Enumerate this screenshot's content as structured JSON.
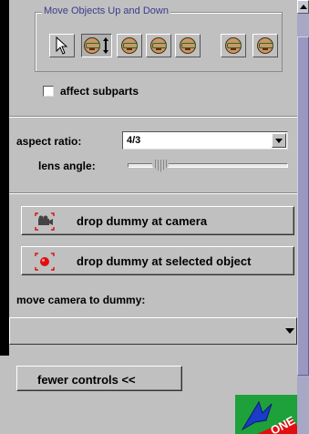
{
  "move_objects": {
    "group_title": "Move Objects Up and Down",
    "tools": [
      {
        "name": "pointer-tool",
        "selected": false
      },
      {
        "name": "up-down-tool",
        "selected": true
      },
      {
        "name": "face-tool-1",
        "selected": false
      },
      {
        "name": "face-tool-2",
        "selected": false
      },
      {
        "name": "face-tool-3",
        "selected": false
      },
      {
        "name": "face-tool-4",
        "selected": false
      },
      {
        "name": "face-tool-5",
        "selected": false
      }
    ],
    "affect_subparts": {
      "label": "affect subparts",
      "checked": false
    }
  },
  "camera": {
    "aspect_ratio_label": "aspect ratio:",
    "aspect_ratio_value": "4/3",
    "lens_angle_label": "lens angle:",
    "lens_angle_fraction": 0.17
  },
  "actions": {
    "drop_dummy_camera": "drop dummy at camera",
    "drop_dummy_selected": "drop dummy at selected object",
    "move_camera_label": "move camera to dummy:",
    "move_camera_value": ""
  },
  "footer": {
    "fewer_controls": "fewer controls  <<",
    "logo_text": "ONE"
  },
  "colors": {
    "panel": "#c0c0c0",
    "scrollbar": "#a7a7c6",
    "group_title": "#3b3b8f",
    "logo_green": "#1ea03a",
    "logo_blue": "#1a3cc8",
    "logo_red": "#e01010"
  }
}
